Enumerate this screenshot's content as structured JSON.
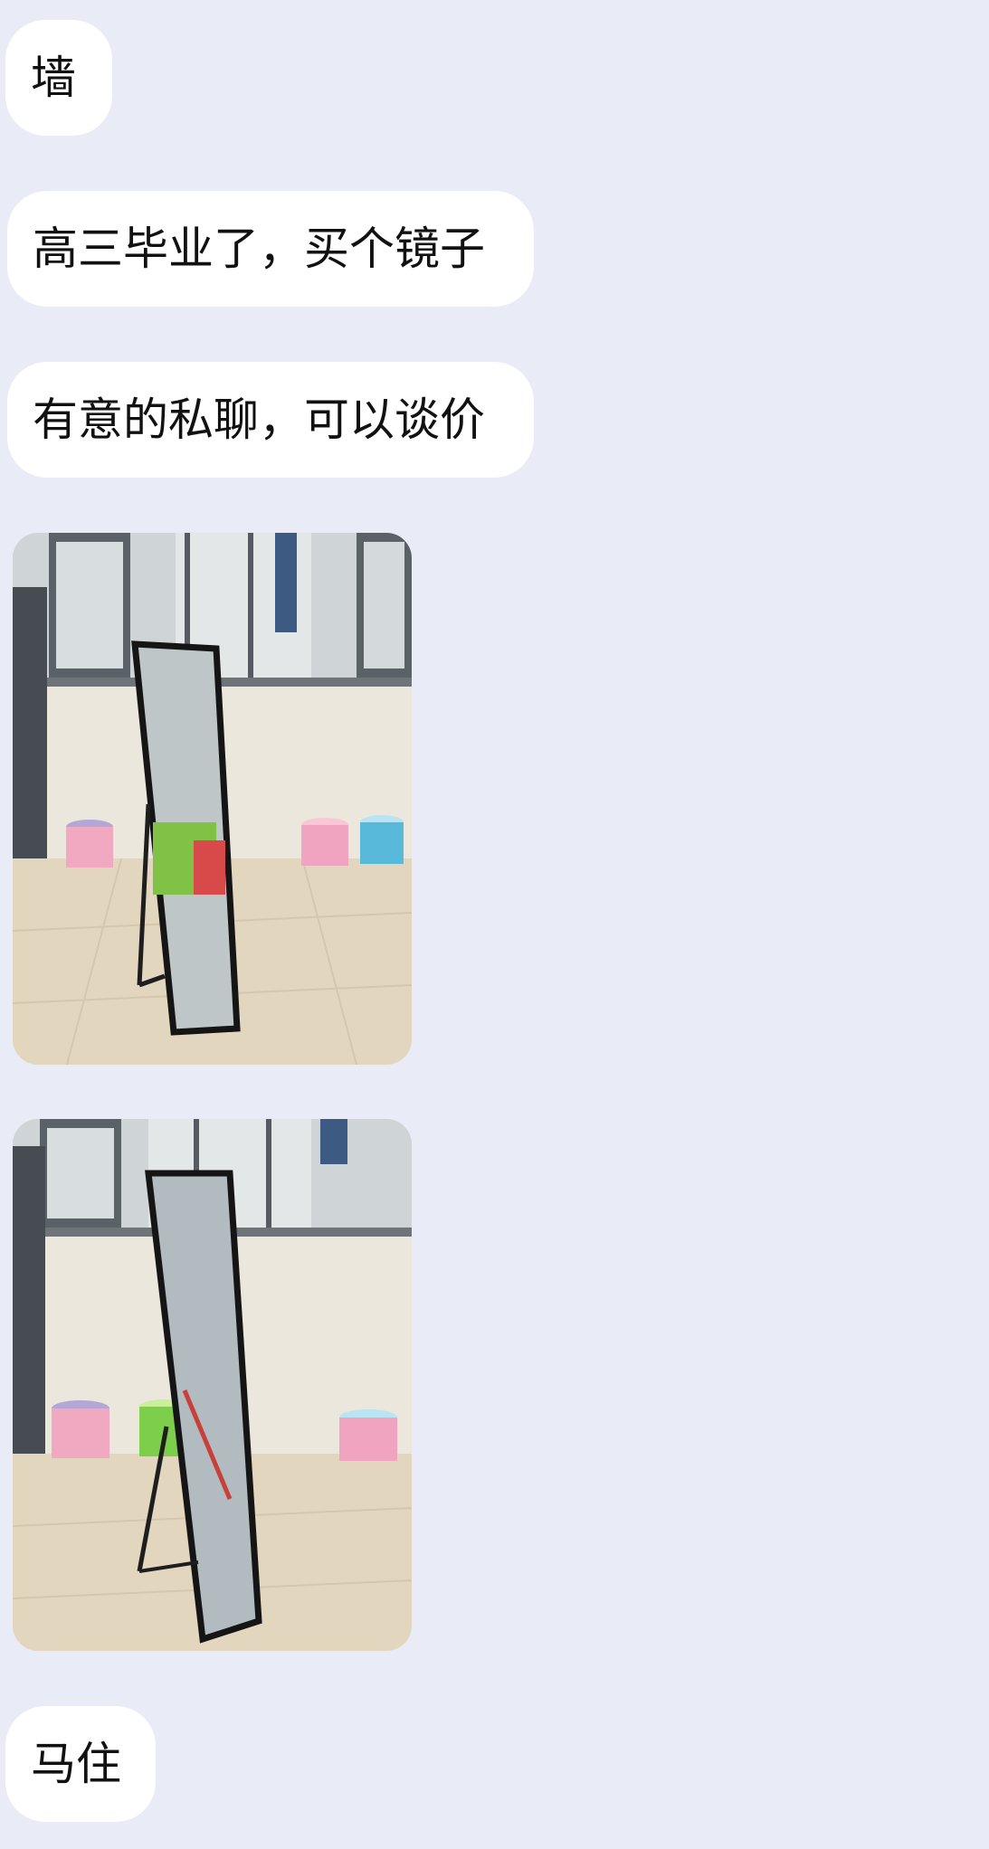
{
  "messages": [
    {
      "text": "墙"
    },
    {
      "text": "高三毕业了，买个镜子"
    },
    {
      "text": "有意的私聊，可以谈价"
    },
    {
      "image": "mirror-photo-1"
    },
    {
      "image": "mirror-photo-2"
    },
    {
      "text": "马住"
    }
  ],
  "colors": {
    "background": "#e9ecf6",
    "bubble": "#ffffff",
    "text": "#111111"
  }
}
